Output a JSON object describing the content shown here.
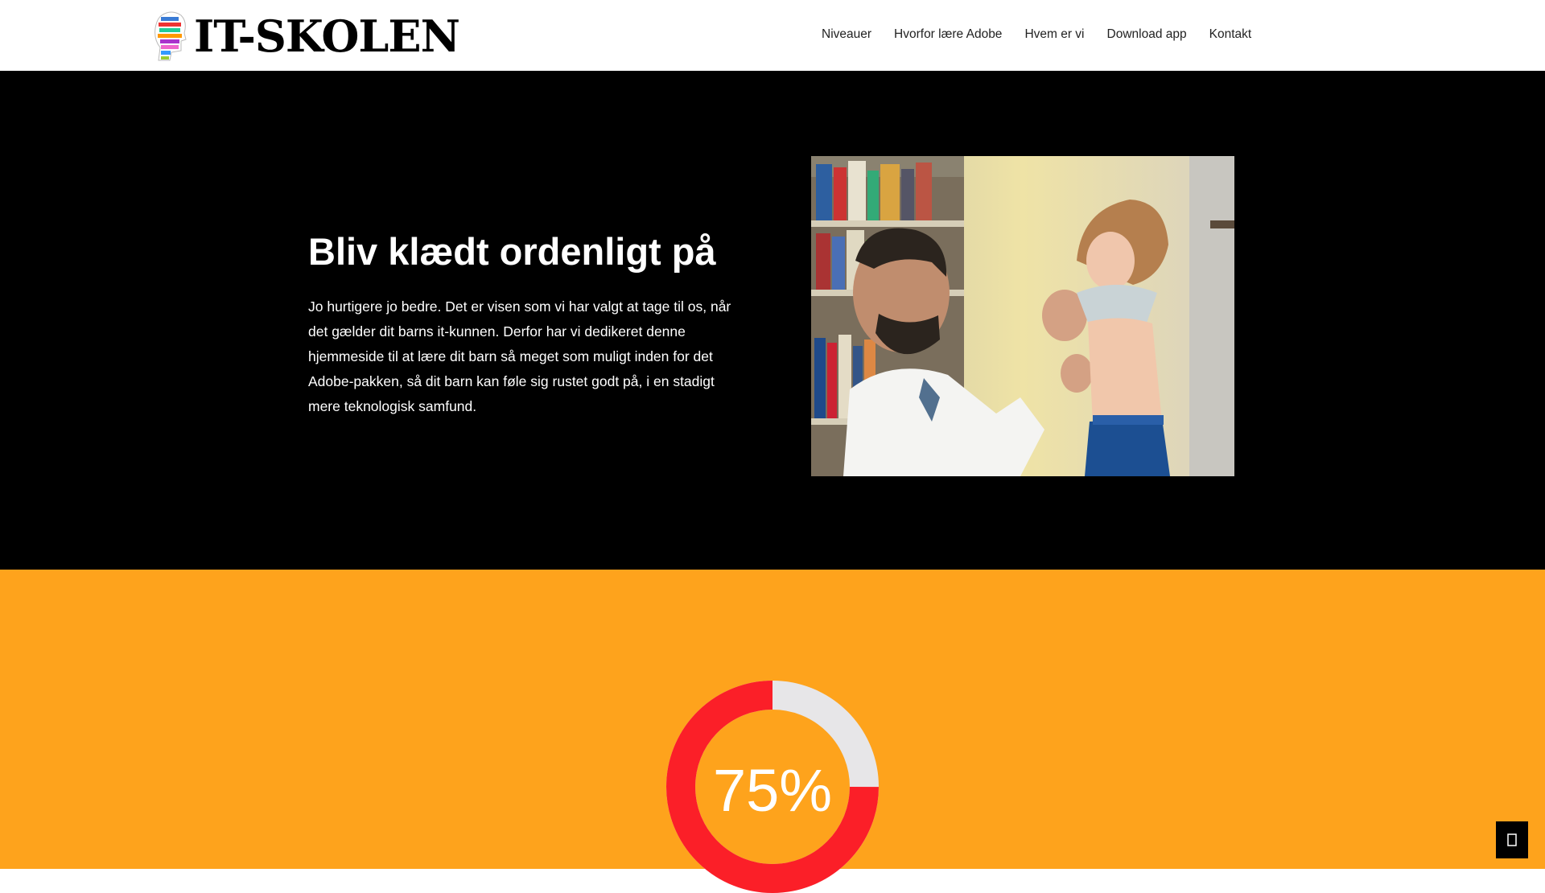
{
  "header": {
    "logo_text": "IT-SKOLEN",
    "nav": [
      {
        "label": "Niveauer"
      },
      {
        "label": "Hvorfor lære Adobe"
      },
      {
        "label": "Hvem er vi"
      },
      {
        "label": "Download app"
      },
      {
        "label": "Kontakt"
      }
    ]
  },
  "hero": {
    "title": "Bliv klædt ordenligt på",
    "text": "Jo hurtigere jo bedre. Det er visen som vi har valgt at tage til os, når det gælder dit barns it-kunnen. Derfor har vi dedikeret denne hjemmeside til at lære dit barn så meget som muligt inden for det Adobe-pakken, så dit barn kan føle sig rustet godt på, i en stadigt mere teknologisk samfund.",
    "photo_icon": "father-dressing-child-photo"
  },
  "stats": {
    "percent_label": "75%",
    "percent_value": 0.75,
    "colors": {
      "fill": "#fb1f28",
      "track": "#e7e6e8",
      "background": "#fea31c"
    }
  },
  "scroll_top": {
    "icon": "arrow-up-icon"
  },
  "colors": {
    "hero_bg": "#000000",
    "header_bg": "#ffffff"
  }
}
